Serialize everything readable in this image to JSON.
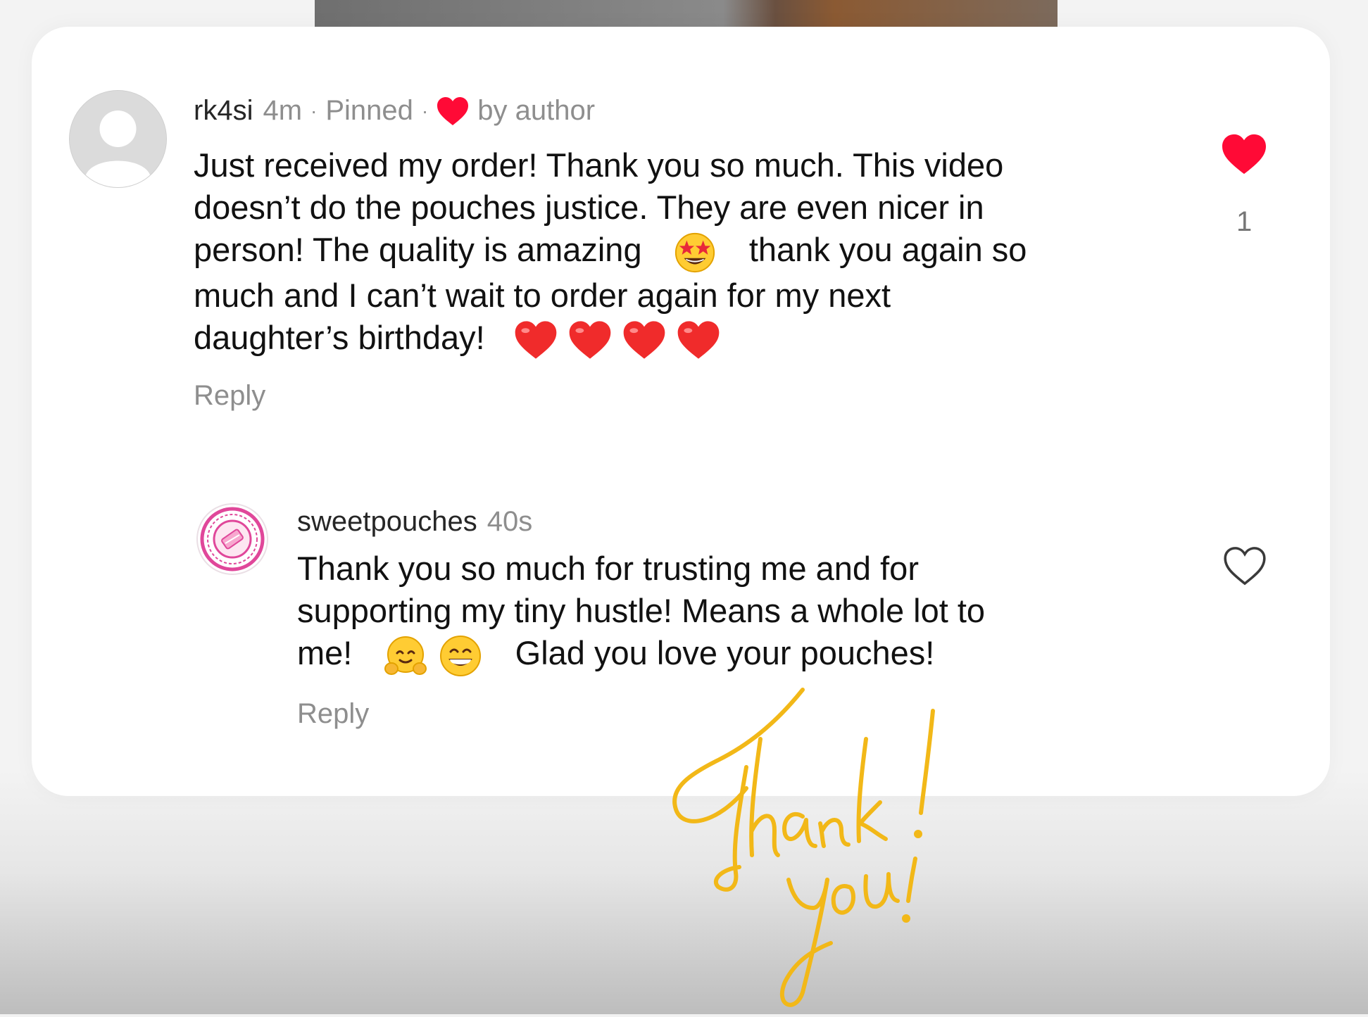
{
  "comments": [
    {
      "username": "rk4si",
      "time": "4m",
      "sep1": "·",
      "pinned_label": "Pinned",
      "sep2": "·",
      "liked_by_author_label": "by author",
      "text_line1": "Just received my order! Thank you so much. This video",
      "text_line2": "doesn’t do the pouches justice. They are even nicer in",
      "text_line3a": "person! The quality is amazing",
      "text_line3b": "thank you again so",
      "text_line4": "much and I can’t wait to order again for my next",
      "text_line5": "daughter’s birthday!",
      "emojis": [
        "star-struck",
        "red-heart",
        "red-heart",
        "red-heart",
        "red-heart"
      ],
      "like_count": "1",
      "liked": true,
      "reply_label": "Reply"
    },
    {
      "username": "sweetpouches",
      "time": "40s",
      "text_line1": "Thank you so much for trusting me and for",
      "text_line2": "supporting my tiny hustle! Means a whole lot to",
      "text_line3a": "me!",
      "text_line3b": "Glad you love your pouches!",
      "emojis": [
        "smiling-face-with-open-hands",
        "beaming-face"
      ],
      "liked": false,
      "reply_label": "Reply"
    }
  ],
  "signature_text": "Thank you!",
  "colors": {
    "heart_red": "#ff0a36",
    "brand_pink": "#e0479a",
    "signature_yellow": "#f2b818",
    "muted_gray": "#8e8e8e"
  }
}
